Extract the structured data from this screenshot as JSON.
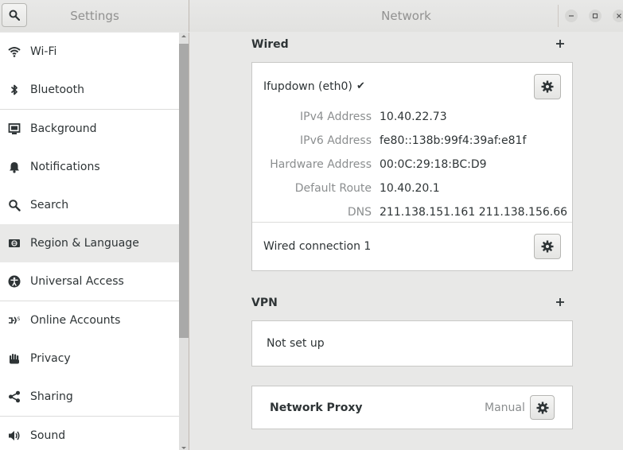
{
  "window": {
    "sidebar_title": "Settings",
    "panel_title": "Network"
  },
  "sidebar": {
    "items": [
      {
        "label": "Wi-Fi",
        "icon": "wifi-icon"
      },
      {
        "label": "Bluetooth",
        "icon": "bluetooth-icon"
      },
      {
        "label": "Background",
        "icon": "background-icon"
      },
      {
        "label": "Notifications",
        "icon": "bell-icon"
      },
      {
        "label": "Search",
        "icon": "search-icon"
      },
      {
        "label": "Region & Language",
        "icon": "region-icon"
      },
      {
        "label": "Universal Access",
        "icon": "accessibility-icon"
      },
      {
        "label": "Online Accounts",
        "icon": "online-accounts-icon"
      },
      {
        "label": "Privacy",
        "icon": "hand-icon"
      },
      {
        "label": "Sharing",
        "icon": "share-icon"
      },
      {
        "label": "Sound",
        "icon": "speaker-icon"
      }
    ],
    "selected": "Region & Language"
  },
  "wired": {
    "title": "Wired",
    "connection": {
      "name": "Ifupdown (eth0)",
      "active_mark": "✔",
      "details": [
        {
          "label": "IPv4 Address",
          "value": "10.40.22.73"
        },
        {
          "label": "IPv6 Address",
          "value": "fe80::138b:99f4:39af:e81f"
        },
        {
          "label": "Hardware Address",
          "value": "00:0C:29:18:BC:D9"
        },
        {
          "label": "Default Route",
          "value": "10.40.20.1"
        },
        {
          "label": "DNS",
          "value": "211.138.151.161 211.138.156.66"
        }
      ]
    },
    "second_connection": {
      "name": "Wired connection 1"
    }
  },
  "vpn": {
    "title": "VPN",
    "empty_text": "Not set up"
  },
  "proxy": {
    "title": "Network Proxy",
    "status": "Manual"
  },
  "colors": {
    "background": "#e8e8e7",
    "sidebar_bg": "#ffffff",
    "selected_row": "#e9e9e8",
    "label_grey": "#8b8e8f"
  }
}
